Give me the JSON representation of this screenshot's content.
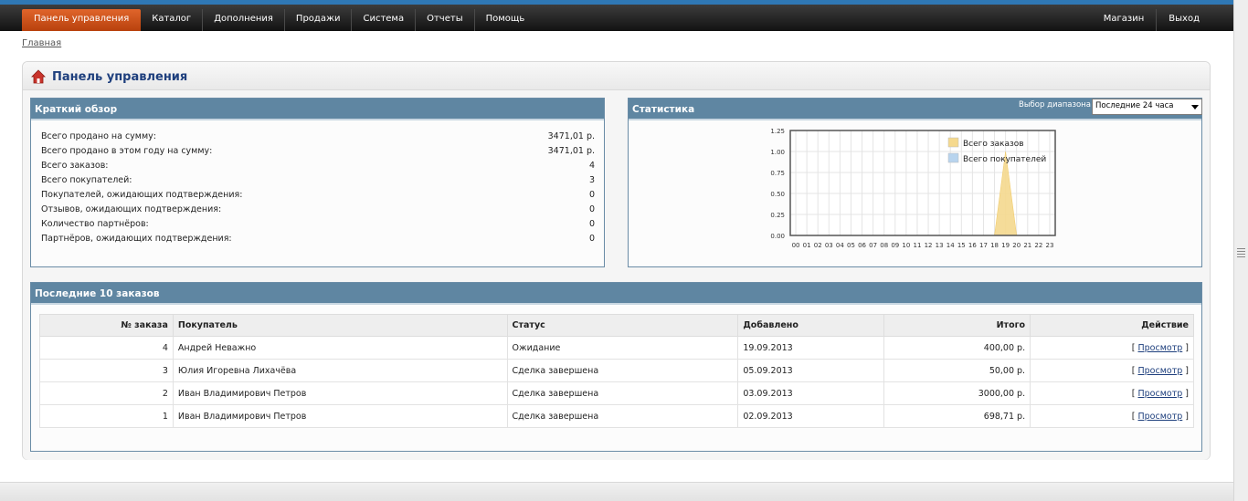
{
  "menu": {
    "items": [
      "Панель управления",
      "Каталог",
      "Дополнения",
      "Продажи",
      "Система",
      "Отчеты",
      "Помощь"
    ],
    "right": [
      "Магазин",
      "Выход"
    ]
  },
  "breadcrumb": "Главная",
  "page_title": "Панель управления",
  "overview": {
    "title": "Краткий обзор",
    "rows": [
      {
        "label": "Всего продано на сумму:",
        "value": "3471,01 р."
      },
      {
        "label": "Всего продано в этом году на сумму:",
        "value": "3471,01 р."
      },
      {
        "label": "Всего заказов:",
        "value": "4"
      },
      {
        "label": "Всего покупателей:",
        "value": "3"
      },
      {
        "label": "Покупателей, ожидающих подтверждения:",
        "value": "0"
      },
      {
        "label": "Отзывов, ожидающих подтверждения:",
        "value": "0"
      },
      {
        "label": "Количество партнёров:",
        "value": "0"
      },
      {
        "label": "Партнёров, ожидающих подтверждения:",
        "value": "0"
      }
    ]
  },
  "stats": {
    "title": "Статистика",
    "range_label": "Выбор диапазона:",
    "range_value": "Последние 24 часа"
  },
  "chart_data": {
    "type": "area",
    "x": [
      "00",
      "01",
      "02",
      "03",
      "04",
      "05",
      "06",
      "07",
      "08",
      "09",
      "10",
      "11",
      "12",
      "13",
      "14",
      "15",
      "16",
      "17",
      "18",
      "19",
      "20",
      "21",
      "22",
      "23"
    ],
    "series": [
      {
        "name": "Всего заказов",
        "color": "#f5d98e",
        "values": [
          0,
          0,
          0,
          0,
          0,
          0,
          0,
          0,
          0,
          0,
          0,
          0,
          0,
          0,
          0,
          0,
          0,
          0,
          0,
          1,
          0,
          0,
          0,
          0
        ]
      },
      {
        "name": "Всего покупателей",
        "color": "#b8d4ee",
        "values": [
          0,
          0,
          0,
          0,
          0,
          0,
          0,
          0,
          0,
          0,
          0,
          0,
          0,
          0,
          0,
          0,
          0,
          0,
          0,
          0,
          0,
          0,
          0,
          0
        ]
      }
    ],
    "ylim": [
      0,
      1.25
    ],
    "yticks": [
      "0.00",
      "0.25",
      "0.50",
      "0.75",
      "1.00",
      "1.25"
    ],
    "grid": true,
    "legend": "top-right"
  },
  "latest": {
    "title": "Последние 10 заказов",
    "headers": [
      "№ заказа",
      "Покупатель",
      "Статус",
      "Добавлено",
      "Итого",
      "Действие"
    ],
    "rows": [
      {
        "id": "4",
        "customer": "Андрей Неважно",
        "status": "Ожидание",
        "date": "19.09.2013",
        "total": "400,00 р.",
        "action": "Просмотр"
      },
      {
        "id": "3",
        "customer": "Юлия Игоревна Лихачёва",
        "status": "Сделка завершена",
        "date": "05.09.2013",
        "total": "50,00 р.",
        "action": "Просмотр"
      },
      {
        "id": "2",
        "customer": "Иван Владимирович Петров",
        "status": "Сделка завершена",
        "date": "03.09.2013",
        "total": "3000,00 р.",
        "action": "Просмотр"
      },
      {
        "id": "1",
        "customer": "Иван Владимирович Петров",
        "status": "Сделка завершена",
        "date": "02.09.2013",
        "total": "698,71 р.",
        "action": "Просмотр"
      }
    ]
  },
  "colors": {
    "menu_active": "#d45520",
    "panel_header": "#5f86a2",
    "title": "#1e3f7d"
  }
}
